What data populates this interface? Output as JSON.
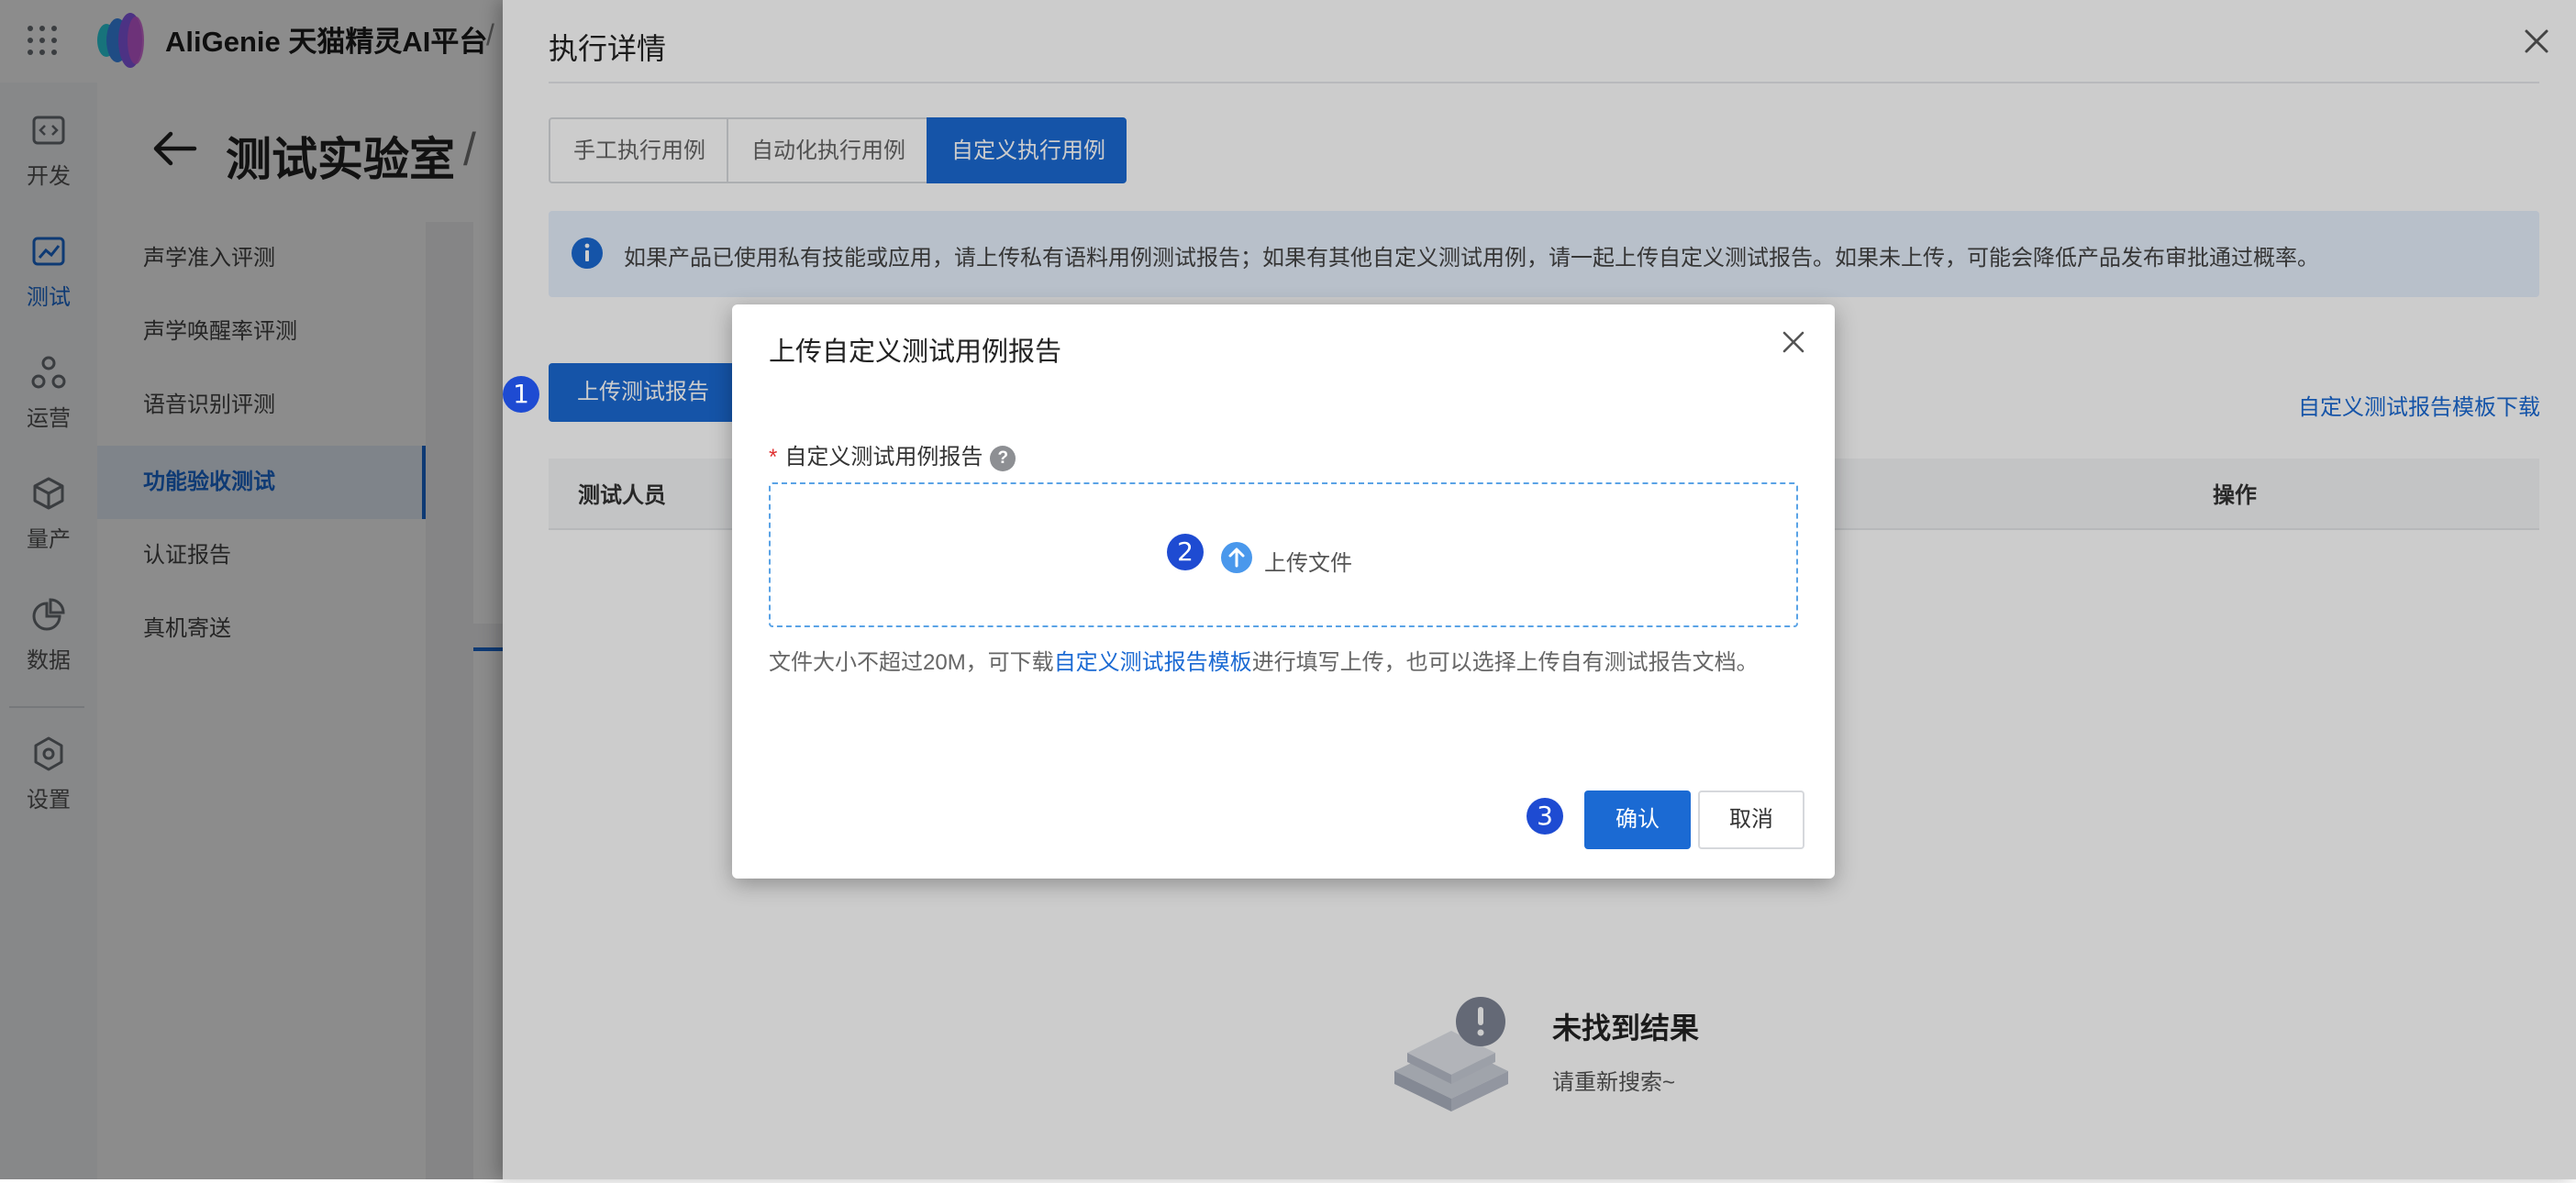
{
  "app": {
    "logo_text": "AliGenie 天猫精灵AI平台",
    "crumb_sep": "/"
  },
  "leftnav": {
    "items": [
      {
        "label": "开发",
        "icon": "code-icon"
      },
      {
        "label": "测试",
        "icon": "chart-line-icon",
        "active": true
      },
      {
        "label": "运营",
        "icon": "operations-icon"
      },
      {
        "label": "量产",
        "icon": "cube-icon"
      },
      {
        "label": "数据",
        "icon": "pie-chart-icon"
      },
      {
        "label": "设置",
        "icon": "gear-icon"
      }
    ]
  },
  "page": {
    "title": "测试实验室",
    "title_sep": "/"
  },
  "subnav": {
    "items": [
      {
        "label": "声学准入评测"
      },
      {
        "label": "声学唤醒率评测"
      },
      {
        "label": "语音识别评测"
      },
      {
        "label": "功能验收测试",
        "active": true
      },
      {
        "label": "认证报告"
      },
      {
        "label": "真机寄送"
      }
    ]
  },
  "drawer": {
    "title": "执行详情",
    "tabs": [
      {
        "label": "手工执行用例"
      },
      {
        "label": "自动化执行用例"
      },
      {
        "label": "自定义执行用例",
        "active": true
      }
    ],
    "alert_text": "如果产品已使用私有技能或应用，请上传私有语料用例测试报告；如果有其他自定义测试用例，请一起上传自定义测试报告。如果未上传，可能会降低产品发布审批通过概率。",
    "upload_button": "上传测试报告",
    "template_link": "自定义测试报告模板下载",
    "table": {
      "col_tester": "测试人员",
      "col_ops": "操作"
    },
    "empty": {
      "title": "未找到结果",
      "subtitle": "请重新搜索~"
    }
  },
  "modal": {
    "title": "上传自定义测试用例报告",
    "field_required_mark": "*",
    "field_label": "自定义测试用例报告",
    "help_mark": "?",
    "dropzone_text": "上传文件",
    "hint_prefix": "文件大小不超过20M，可下载",
    "hint_link": "自定义测试报告模板",
    "hint_suffix": "进行填写上传，也可以选择上传自有测试报告文档。",
    "confirm": "确认",
    "cancel": "取消"
  },
  "steps": [
    "1",
    "2",
    "3"
  ],
  "colors": {
    "primary": "#1b6ad3",
    "step_marker": "#1e4bd2",
    "alert_bg": "#e6f0fd",
    "required": "#e03131"
  }
}
